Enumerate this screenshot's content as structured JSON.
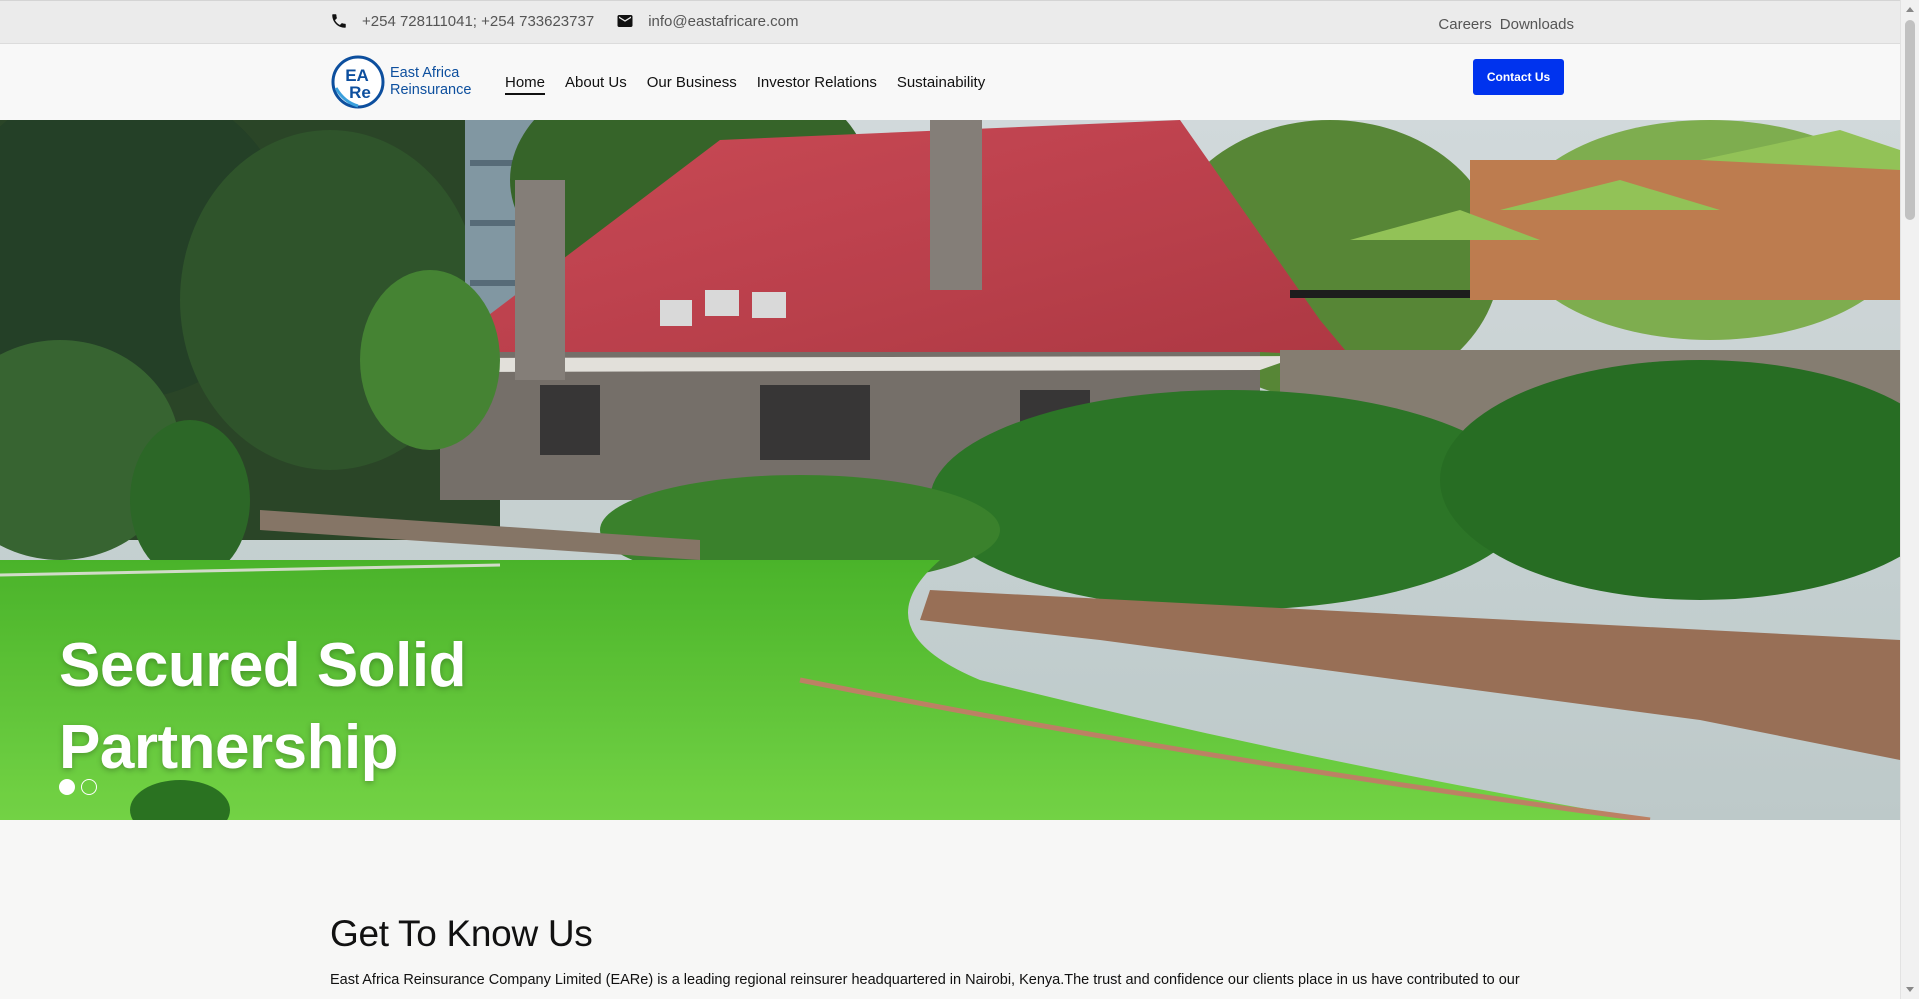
{
  "topbar": {
    "phone_icon": "phone-icon",
    "phone": "+254 728111041; +254 733623737",
    "email_icon": "mail-icon",
    "email": "info@eastafricare.com",
    "links": [
      "Careers",
      "Downloads"
    ]
  },
  "nav": {
    "logo_mark": "EARe",
    "logo_line1": "East Africa",
    "logo_line2": "Reinsurance",
    "items": [
      "Home",
      "About Us",
      "Our Business",
      "Investor Relations",
      "Sustainability"
    ],
    "active": "Home",
    "cta": "Contact Us",
    "brand_color": "#0d4f9e",
    "cta_color": "#0033ee"
  },
  "hero": {
    "title_line1": "Secured Solid",
    "title_line2": "Partnership",
    "slides": 2,
    "active_slide": 1
  },
  "about": {
    "heading": "Get To Know Us",
    "body": "East Africa Reinsurance Company Limited (EARe) is a leading regional reinsurer headquartered in Nairobi, Kenya.The trust and confidence our clients place in us have contributed to our"
  }
}
